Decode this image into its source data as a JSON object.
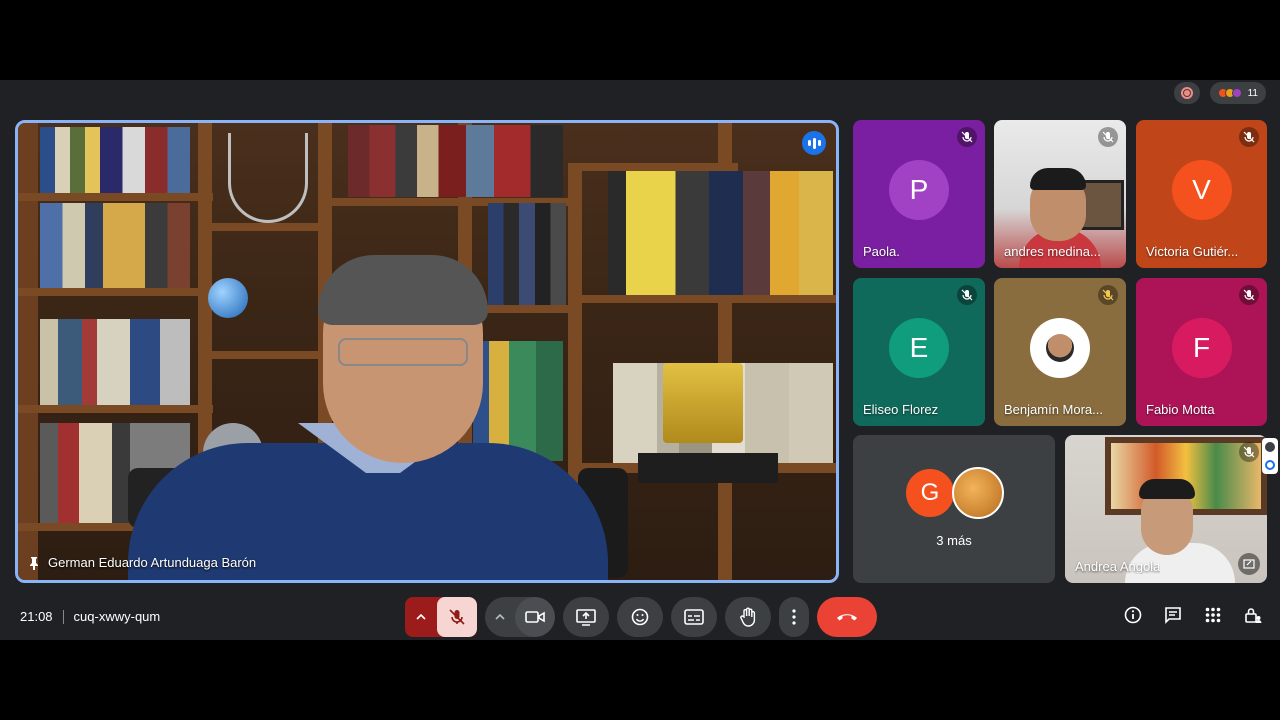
{
  "top": {
    "people_count": "11"
  },
  "main": {
    "name": "German Eduardo Artunduaga Barón"
  },
  "tiles": [
    {
      "name": "Paola.",
      "initial": "P",
      "bg": "#7b1fa2",
      "avatar": "#a142c4"
    },
    {
      "name": "andres medina...",
      "initial": "",
      "bg": "#d9d9d9",
      "avatar": ""
    },
    {
      "name": "Victoria Gutiér...",
      "initial": "V",
      "bg": "#c0461a",
      "avatar": "#f4511e"
    },
    {
      "name": "Eliseo Florez",
      "initial": "E",
      "bg": "#106a5c",
      "avatar": "#0f9d7e"
    },
    {
      "name": "Benjamín Mora...",
      "initial": "",
      "bg": "#8a6d3f",
      "avatar": ""
    },
    {
      "name": "Fabio Motta",
      "initial": "F",
      "bg": "#ad1457",
      "avatar": "#d81b60"
    }
  ],
  "more": {
    "initial": "G",
    "label": "3 más"
  },
  "self_tile": {
    "name": "Andrea Angola"
  },
  "bottom": {
    "time": "21:08",
    "code": "cuq-xwwy-qum"
  },
  "colors": {
    "accent": "#8ab4f8",
    "hangup": "#ea4335",
    "bar": "#202124"
  }
}
